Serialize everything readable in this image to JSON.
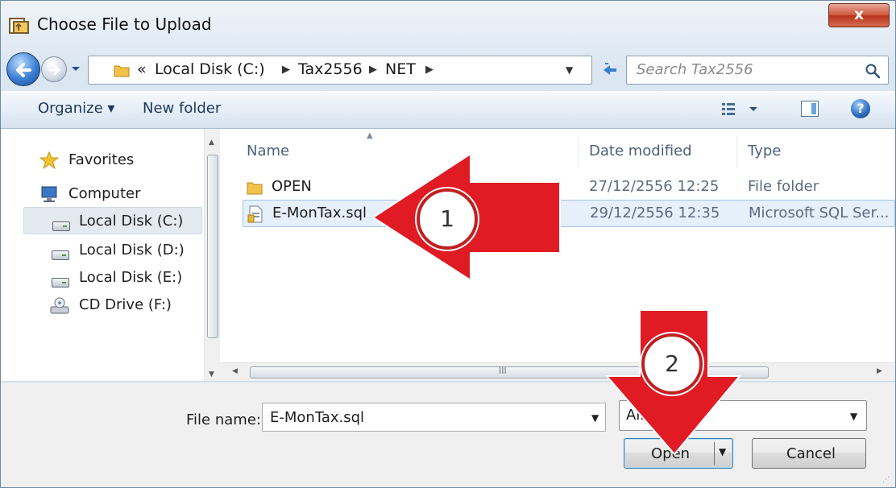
{
  "window": {
    "title": "Choose File to Upload",
    "close_label": "x"
  },
  "nav": {
    "address": {
      "overflow": "«",
      "crumbs": [
        "Local Disk (C:)",
        "Tax2556",
        "NET"
      ]
    },
    "search_placeholder": "Search Tax2556"
  },
  "toolbar": {
    "organize_label": "Organize ▾",
    "new_folder_label": "New folder",
    "help_label": "?"
  },
  "sidebar": {
    "items": [
      {
        "label": "Favorites",
        "icon": "star-icon"
      },
      {
        "label": "Computer",
        "icon": "computer-icon"
      },
      {
        "label": "Local Disk (C:)",
        "icon": "drive-icon",
        "selected": true
      },
      {
        "label": "Local Disk (D:)",
        "icon": "drive-icon"
      },
      {
        "label": "Local Disk (E:)",
        "icon": "drive-icon"
      },
      {
        "label": "CD Drive (F:)",
        "icon": "cd-drive-icon"
      }
    ]
  },
  "files": {
    "columns": {
      "name": "Name",
      "date": "Date modified",
      "type": "Type"
    },
    "rows": [
      {
        "name": "OPEN",
        "date": "27/12/2556 12:25",
        "type": "File folder",
        "icon": "folder-icon"
      },
      {
        "name": "E-MonTax.sql",
        "date": "29/12/2556 12:35",
        "type": "Microsoft SQL Ser...",
        "icon": "sql-file-icon",
        "selected": true
      }
    ],
    "hscroll_grip": "III"
  },
  "bottom": {
    "file_name_label": "File name:",
    "file_name_value": "E-MonTax.sql",
    "filter_value": "All ... )",
    "open_label": "Open",
    "cancel_label": "Cancel"
  },
  "annotations": {
    "badge_1": "1",
    "badge_2": "2",
    "arrow_color": "#e01b24"
  },
  "colors": {
    "accent": "#3c7fb1",
    "close_button": "#c8452b",
    "toolbar_text": "#1e395b"
  }
}
